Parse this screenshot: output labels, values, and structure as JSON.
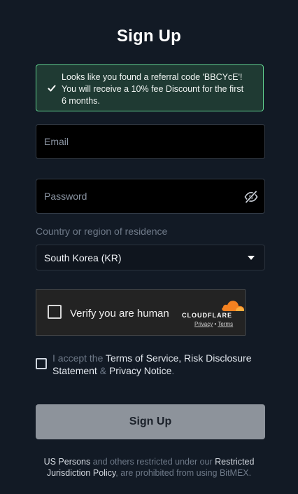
{
  "page": {
    "title": "Sign Up"
  },
  "referral": {
    "icon": "check-icon",
    "line1": "Looks like you found a referral code 'BBCYcE'!",
    "line2": "You will receive a 10% fee Discount for the first",
    "line3": "6 months.",
    "border_color": "#5fcf8d",
    "background": "#1f3a33"
  },
  "form": {
    "email_placeholder": "Email",
    "email_value": "",
    "password_placeholder": "Password",
    "password_value": "",
    "password_toggle_icon": "eye-slash-icon",
    "country_label": "Country or region of residence",
    "country_selected": "South Korea (KR)",
    "country_caret_icon": "caret-down-icon"
  },
  "captcha": {
    "label": "Verify you are human",
    "brand": "CLOUDFLARE",
    "brand_icon": "cloudflare-cloud-icon",
    "privacy": "Privacy",
    "separator": "•",
    "terms": "Terms",
    "checked": false
  },
  "terms": {
    "checked": false,
    "prefix": "I accept the ",
    "tos": "Terms of Service",
    "comma": ", ",
    "risk": "Risk Disclosure Statement",
    "amp": " & ",
    "privacy": "Privacy Notice",
    "period": "."
  },
  "submit": {
    "label": "Sign Up",
    "background": "#8d939b"
  },
  "footer": {
    "us_persons": "US Persons",
    "middle": " and others restricted under our ",
    "policy": "Restricted Jurisdiction Policy",
    "suffix": ", are prohibited from using BitMEX."
  }
}
